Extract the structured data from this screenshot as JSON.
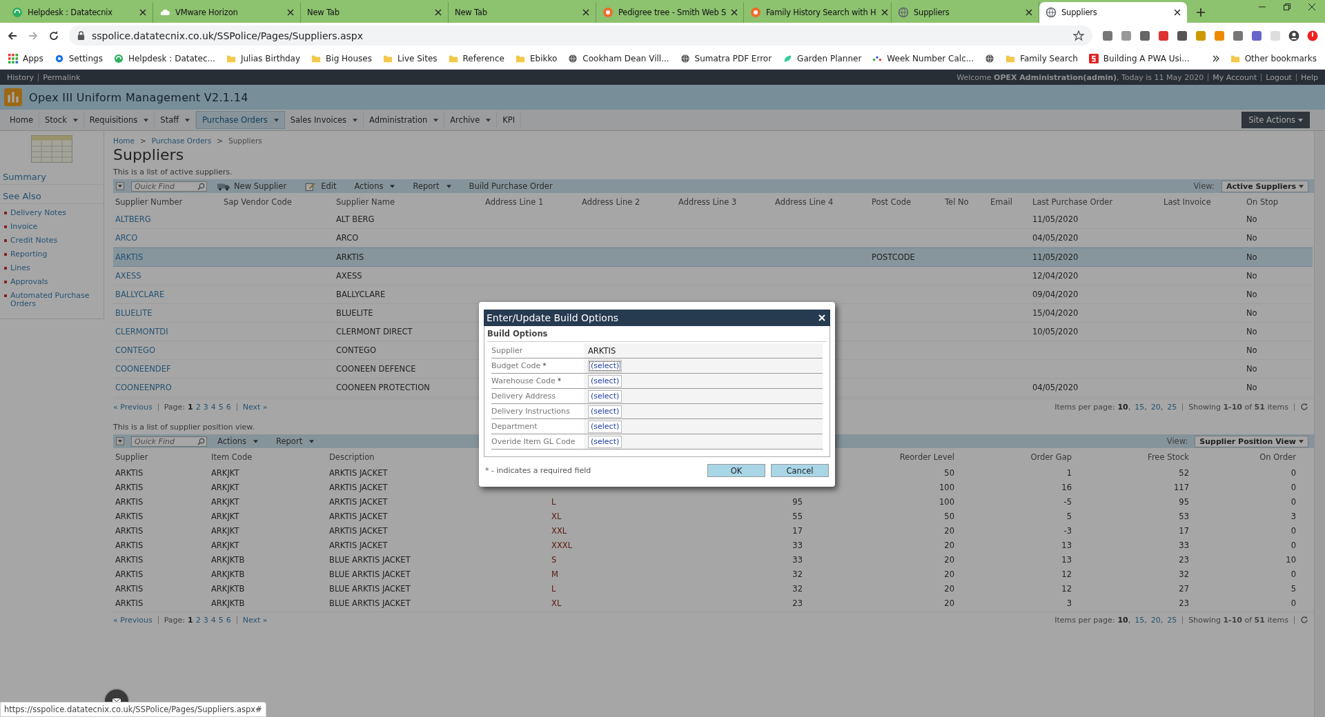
{
  "browser": {
    "tabs": [
      {
        "title": "Helpdesk : Datatecnix",
        "kind": "headset",
        "selected": false
      },
      {
        "title": "VMware Horizon",
        "kind": "cloud",
        "selected": false
      },
      {
        "title": "New Tab",
        "kind": "blank",
        "selected": false
      },
      {
        "title": "New Tab",
        "kind": "blank",
        "selected": false
      },
      {
        "title": "Pedigree tree - Smith Web S",
        "kind": "ring",
        "selected": false
      },
      {
        "title": "Family History Search with H",
        "kind": "ring",
        "selected": false
      },
      {
        "title": "Suppliers",
        "kind": "globe",
        "selected": false
      },
      {
        "title": "Suppliers",
        "kind": "globe",
        "selected": true
      }
    ],
    "url": "sspolice.datatecnix.co.uk/SSPolice/Pages/Suppliers.aspx",
    "bookmarks": [
      {
        "label": "Apps",
        "kind": "apps"
      },
      {
        "label": "Settings",
        "kind": "gear"
      },
      {
        "label": "Helpdesk : Datatec...",
        "kind": "headset"
      },
      {
        "label": "Julias Birthday",
        "kind": "folder"
      },
      {
        "label": "Big Houses",
        "kind": "folder"
      },
      {
        "label": "Live Sites",
        "kind": "folder"
      },
      {
        "label": "Reference",
        "kind": "folder"
      },
      {
        "label": "Ebikko",
        "kind": "folder"
      },
      {
        "label": "Cookham Dean Vill...",
        "kind": "globe"
      },
      {
        "label": "Sumatra PDF Error",
        "kind": "globe"
      },
      {
        "label": "Garden Planner",
        "kind": "leaf"
      },
      {
        "label": "Week Number Calc...",
        "kind": "dots"
      },
      {
        "kind": "globe"
      },
      {
        "label": "Family Search",
        "kind": "folder"
      },
      {
        "label": "Building A PWA Usi...",
        "kind": "red"
      }
    ],
    "other_bookmarks": "Other bookmarks",
    "status_url": "https://sspolice.datatecnix.co.uk/SSPolice/Pages/Suppliers.aspx#"
  },
  "top_bar": {
    "links": [
      "History",
      "Permalink"
    ],
    "welcome": "Welcome **OPEX Administration(admin)**, Today is 11 May 2020",
    "user_links": [
      "My Account",
      "Logout",
      "Help"
    ]
  },
  "app_title": "Opex III Uniform Management V2.1.14",
  "nav": [
    {
      "label": "Home",
      "has_menu": false,
      "selected": false
    },
    {
      "label": "Stock",
      "has_menu": true,
      "selected": false
    },
    {
      "label": "Requisitions",
      "has_menu": true,
      "selected": false
    },
    {
      "label": "Staff",
      "has_menu": true,
      "selected": false
    },
    {
      "label": "Purchase Orders",
      "has_menu": true,
      "selected": true
    },
    {
      "label": "Sales Invoices",
      "has_menu": true,
      "selected": false
    },
    {
      "label": "Administration",
      "has_menu": true,
      "selected": false
    },
    {
      "label": "Archive",
      "has_menu": true,
      "selected": false
    },
    {
      "label": "KPI",
      "has_menu": false,
      "selected": false
    }
  ],
  "site_actions": "Site Actions",
  "sidebar": {
    "summary": "Summary",
    "see_also": "See Also",
    "items": [
      "Delivery Notes",
      "Invoice",
      "Credit Notes",
      "Reporting",
      "Lines",
      "Approvals",
      "Automated Purchase Orders"
    ]
  },
  "breadcrumb": {
    "separator": ">",
    "items": [
      "Home",
      "Purchase Orders",
      "Suppliers"
    ]
  },
  "page_title": "Suppliers",
  "suppliers": {
    "description": "This is a list of active suppliers.",
    "toolbar": {
      "quick_find_placeholder": "Quick Find",
      "buttons": [
        {
          "label": "New Supplier",
          "kind": "truck",
          "has_menu": false
        },
        {
          "label": "Edit",
          "kind": "edit",
          "has_menu": false
        },
        {
          "label": "Actions",
          "kind": "plain",
          "has_menu": true
        },
        {
          "label": "Report",
          "kind": "plain",
          "has_menu": true
        },
        {
          "label": "Build Purchase Order",
          "kind": "plain",
          "has_menu": false
        }
      ],
      "view_label": "View:",
      "view": "Active Suppliers"
    },
    "columns": [
      "Supplier Number",
      "Sap Vendor Code",
      "Supplier Name",
      "Address Line 1",
      "Address Line 2",
      "Address Line 3",
      "Address Line 4",
      "Post Code",
      "Tel No",
      "Email",
      "Last Purchase Order",
      "Last Invoice",
      "On Stop"
    ],
    "rows": [
      {
        "selected": false,
        "cells": [
          "ALTBERG",
          null,
          "ALT BERG",
          null,
          null,
          null,
          null,
          null,
          null,
          null,
          "11/05/2020",
          null,
          "No"
        ]
      },
      {
        "selected": false,
        "cells": [
          "ARCO",
          null,
          "ARCO",
          null,
          null,
          null,
          null,
          null,
          null,
          null,
          "04/05/2020",
          null,
          "No"
        ]
      },
      {
        "selected": true,
        "cells": [
          "ARKTIS",
          null,
          "ARKTIS",
          null,
          null,
          null,
          null,
          "POSTCODE",
          null,
          null,
          "11/05/2020",
          null,
          "No"
        ]
      },
      {
        "selected": false,
        "cells": [
          "AXESS",
          null,
          "AXESS",
          null,
          null,
          null,
          null,
          null,
          null,
          null,
          "12/04/2020",
          null,
          "No"
        ]
      },
      {
        "selected": false,
        "cells": [
          "BALLYCLARE",
          null,
          "BALLYCLARE",
          null,
          null,
          null,
          null,
          null,
          null,
          null,
          "09/04/2020",
          null,
          "No"
        ]
      },
      {
        "selected": false,
        "cells": [
          "BLUELITE",
          null,
          "BLUELITE",
          null,
          null,
          null,
          null,
          null,
          null,
          null,
          "15/04/2020",
          null,
          "No"
        ]
      },
      {
        "selected": false,
        "cells": [
          "CLERMONTDI",
          null,
          "CLERMONT DIRECT",
          null,
          null,
          null,
          null,
          null,
          null,
          null,
          "10/05/2020",
          null,
          "No"
        ]
      },
      {
        "selected": false,
        "cells": [
          "CONTEGO",
          null,
          "CONTEGO",
          null,
          null,
          null,
          null,
          null,
          null,
          null,
          null,
          null,
          "No"
        ]
      },
      {
        "selected": false,
        "cells": [
          "COONEENDEF",
          null,
          "COONEEN DEFENCE",
          null,
          null,
          null,
          null,
          null,
          null,
          null,
          null,
          null,
          "No"
        ]
      },
      {
        "selected": false,
        "cells": [
          "COONEENPRO",
          null,
          "COONEEN PROTECTION",
          null,
          null,
          null,
          null,
          null,
          null,
          null,
          "04/05/2020",
          null,
          "No"
        ]
      }
    ],
    "pager": {
      "previous": "« Previous",
      "page_label": "Page:",
      "pages": [
        {
          "label": "1",
          "selected": true
        },
        {
          "label": "2",
          "selected": false
        },
        {
          "label": "3",
          "selected": false
        },
        {
          "label": "4",
          "selected": false
        },
        {
          "label": "5",
          "selected": false
        },
        {
          "label": "6",
          "selected": false
        }
      ],
      "next": "Next »",
      "per_page_label": "Items per page:",
      "per_page": [
        {
          "label": "10",
          "selected": true
        },
        {
          "label": "15",
          "selected": false
        },
        {
          "label": "20",
          "selected": false
        },
        {
          "label": "25",
          "selected": false
        }
      ],
      "list_separator": ",",
      "showing": "Showing **1-10** of **51** items"
    }
  },
  "positions": {
    "description": "This is a list of supplier position view.",
    "toolbar": {
      "quick_find_placeholder": "Quick Find",
      "buttons": [
        {
          "label": "Actions",
          "kind": "plain",
          "has_menu": true
        },
        {
          "label": "Report",
          "kind": "plain",
          "has_menu": true
        }
      ],
      "view_label": "View:",
      "view": "Supplier Position View"
    },
    "columns": [
      "Supplier",
      "Item Code",
      "Description",
      null,
      null,
      "Reorder Level",
      "Order Gap",
      "Free Stock",
      "On Order"
    ],
    "rows": [
      [
        "ARKTIS",
        "ARKJKT",
        "ARKTIS JACKET",
        null,
        null,
        "50",
        "1",
        "52",
        "0"
      ],
      [
        "ARKTIS",
        "ARKJKT",
        "ARKTIS JACKET",
        null,
        null,
        "100",
        "16",
        "117",
        "0"
      ],
      [
        "ARKTIS",
        "ARKJKT",
        "ARKTIS JACKET",
        "L",
        "95",
        "100",
        "-5",
        "95",
        "0"
      ],
      [
        "ARKTIS",
        "ARKJKT",
        "ARKTIS JACKET",
        "XL",
        "55",
        "50",
        "5",
        "53",
        "3"
      ],
      [
        "ARKTIS",
        "ARKJKT",
        "ARKTIS JACKET",
        "XXL",
        "17",
        "20",
        "-3",
        "17",
        "0"
      ],
      [
        "ARKTIS",
        "ARKJKT",
        "ARKTIS JACKET",
        "XXXL",
        "33",
        "20",
        "13",
        "33",
        "0"
      ],
      [
        "ARKTIS",
        "ARKJKTB",
        "BLUE ARKTIS JACKET",
        "S",
        "33",
        "20",
        "13",
        "23",
        "10"
      ],
      [
        "ARKTIS",
        "ARKJKTB",
        "BLUE ARKTIS JACKET",
        "M",
        "32",
        "20",
        "12",
        "32",
        "0"
      ],
      [
        "ARKTIS",
        "ARKJKTB",
        "BLUE ARKTIS JACKET",
        "L",
        "32",
        "20",
        "12",
        "27",
        "5"
      ],
      [
        "ARKTIS",
        "ARKJKTB",
        "BLUE ARKTIS JACKET",
        "XL",
        "23",
        "20",
        "3",
        "23",
        "0"
      ]
    ],
    "pager": {
      "previous": "« Previous",
      "page_label": "Page:",
      "pages": [
        {
          "label": "1",
          "selected": true
        },
        {
          "label": "2",
          "selected": false
        },
        {
          "label": "3",
          "selected": false
        },
        {
          "label": "4",
          "selected": false
        },
        {
          "label": "5",
          "selected": false
        },
        {
          "label": "6",
          "selected": false
        }
      ],
      "next": "Next »",
      "per_page_label": "Items per page:",
      "per_page": [
        {
          "label": "10",
          "selected": true
        },
        {
          "label": "15",
          "selected": false
        },
        {
          "label": "20",
          "selected": false
        },
        {
          "label": "25",
          "selected": false
        }
      ],
      "list_separator": ",",
      "showing": "Showing **1-10** of **51** items"
    }
  },
  "dialog": {
    "title": "Enter/Update Build Options",
    "section": "Build Options",
    "fields": [
      {
        "label": "Supplier",
        "required": false,
        "kind": "text",
        "value": "ARKTIS"
      },
      {
        "label": "Budget Code",
        "required": true,
        "kind": "select",
        "value": "(select)",
        "focused": true
      },
      {
        "label": "Warehouse Code",
        "required": true,
        "kind": "select",
        "value": "(select)",
        "focused": false
      },
      {
        "label": "Delivery Address",
        "required": false,
        "kind": "select",
        "value": "(select)",
        "focused": false
      },
      {
        "label": "Delivery Instructions",
        "required": false,
        "kind": "select",
        "value": "(select)",
        "focused": false
      },
      {
        "label": "Department",
        "required": false,
        "kind": "select",
        "value": "(select)",
        "focused": false
      },
      {
        "label": "Overide Item GL Code",
        "required": false,
        "kind": "select",
        "value": "(select)",
        "focused": false
      }
    ],
    "required_mark": "*",
    "note": "* - indicates a required field",
    "ok": "OK",
    "cancel": "Cancel"
  }
}
